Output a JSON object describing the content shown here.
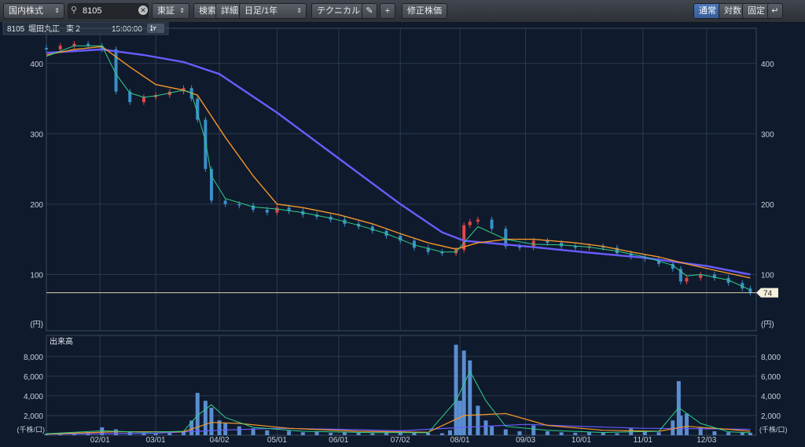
{
  "toolbar": {
    "market_select": "国内株式",
    "search_value": "8105",
    "exchange_select": "東証",
    "search_button": "検索",
    "detail_button": "詳細",
    "period_select": "日足/1年",
    "technical_button": "テクニカル",
    "adjusted_price_button": "修正株価",
    "scale_normal": "通常",
    "scale_log": "対数",
    "scale_fixed": "固定"
  },
  "stock_header": {
    "code": "8105",
    "name": "堀田丸正",
    "market": "東２",
    "time": "15:00:00"
  },
  "colors": {
    "background": "#0f1a2c",
    "grid": "#2a3a52",
    "up_candle": "#e04848",
    "down_candle": "#3a8fc8",
    "ma_short": "#2fd08a",
    "ma_mid": "#f5962a",
    "ma_long": "#6a5cff",
    "volume_bar": "#5a8ed0",
    "price_line": "#d8d0a8"
  },
  "chart_data": {
    "type": "candlestick",
    "price_panel": {
      "y_ticks": [
        100,
        200,
        300,
        400
      ],
      "y_unit": "(円)",
      "ylim": [
        20,
        450
      ],
      "current_price": 74,
      "x_ticks": [
        "02/01",
        "03/01",
        "04/02",
        "05/01",
        "06/01",
        "07/02",
        "08/01",
        "09/03",
        "10/01",
        "11/01",
        "12/03"
      ],
      "close_series": [
        [
          "01/05",
          420
        ],
        [
          "01/12",
          425
        ],
        [
          "01/19",
          428
        ],
        [
          "01/26",
          425
        ],
        [
          "02/02",
          420
        ],
        [
          "02/09",
          360
        ],
        [
          "02/16",
          345
        ],
        [
          "02/23",
          352
        ],
        [
          "03/01",
          355
        ],
        [
          "03/08",
          360
        ],
        [
          "03/15",
          365
        ],
        [
          "03/19",
          350
        ],
        [
          "03/22",
          320
        ],
        [
          "03/26",
          250
        ],
        [
          "03/29",
          205
        ],
        [
          "04/05",
          200
        ],
        [
          "04/12",
          198
        ],
        [
          "04/19",
          192
        ],
        [
          "04/26",
          188
        ],
        [
          "05/01",
          195
        ],
        [
          "05/07",
          190
        ],
        [
          "05/14",
          185
        ],
        [
          "05/21",
          182
        ],
        [
          "05/28",
          178
        ],
        [
          "06/04",
          172
        ],
        [
          "06/11",
          168
        ],
        [
          "06/18",
          162
        ],
        [
          "06/25",
          155
        ],
        [
          "07/02",
          148
        ],
        [
          "07/09",
          138
        ],
        [
          "07/16",
          132
        ],
        [
          "07/23",
          130
        ],
        [
          "07/30",
          135
        ],
        [
          "08/03",
          170
        ],
        [
          "08/06",
          175
        ],
        [
          "08/10",
          178
        ],
        [
          "08/17",
          165
        ],
        [
          "08/24",
          140
        ],
        [
          "08/31",
          138
        ],
        [
          "09/07",
          148
        ],
        [
          "09/14",
          145
        ],
        [
          "09/21",
          140
        ],
        [
          "09/28",
          138
        ],
        [
          "10/05",
          140
        ],
        [
          "10/12",
          138
        ],
        [
          "10/19",
          130
        ],
        [
          "10/26",
          125
        ],
        [
          "11/02",
          122
        ],
        [
          "11/09",
          115
        ],
        [
          "11/16",
          108
        ],
        [
          "11/20",
          90
        ],
        [
          "11/23",
          95
        ],
        [
          "11/30",
          100
        ],
        [
          "12/07",
          95
        ],
        [
          "12/14",
          88
        ],
        [
          "12/21",
          80
        ],
        [
          "12/25",
          74
        ]
      ],
      "ma_short": [
        [
          "01/05",
          410
        ],
        [
          "01/19",
          425
        ],
        [
          "02/02",
          425
        ],
        [
          "02/09",
          385
        ],
        [
          "02/16",
          358
        ],
        [
          "02/23",
          352
        ],
        [
          "03/01",
          354
        ],
        [
          "03/15",
          362
        ],
        [
          "03/19",
          358
        ],
        [
          "03/26",
          290
        ],
        [
          "03/29",
          240
        ],
        [
          "04/05",
          208
        ],
        [
          "04/19",
          196
        ],
        [
          "05/01",
          193
        ],
        [
          "05/14",
          188
        ],
        [
          "05/28",
          180
        ],
        [
          "06/11",
          170
        ],
        [
          "06/25",
          158
        ],
        [
          "07/09",
          142
        ],
        [
          "07/23",
          132
        ],
        [
          "07/30",
          132
        ],
        [
          "08/03",
          145
        ],
        [
          "08/10",
          168
        ],
        [
          "08/24",
          150
        ],
        [
          "09/07",
          143
        ],
        [
          "09/21",
          142
        ],
        [
          "10/05",
          139
        ],
        [
          "10/19",
          133
        ],
        [
          "11/02",
          125
        ],
        [
          "11/16",
          113
        ],
        [
          "11/23",
          98
        ],
        [
          "11/30",
          100
        ],
        [
          "12/14",
          92
        ],
        [
          "12/25",
          78
        ]
      ],
      "ma_mid": [
        [
          "01/05",
          412
        ],
        [
          "01/19",
          420
        ],
        [
          "02/02",
          424
        ],
        [
          "02/16",
          395
        ],
        [
          "03/01",
          370
        ],
        [
          "03/15",
          362
        ],
        [
          "03/22",
          355
        ],
        [
          "04/05",
          295
        ],
        [
          "04/19",
          240
        ],
        [
          "05/01",
          200
        ],
        [
          "05/14",
          195
        ],
        [
          "06/01",
          185
        ],
        [
          "06/18",
          172
        ],
        [
          "07/02",
          158
        ],
        [
          "07/16",
          145
        ],
        [
          "07/30",
          136
        ],
        [
          "08/10",
          145
        ],
        [
          "08/24",
          150
        ],
        [
          "09/07",
          150
        ],
        [
          "09/28",
          145
        ],
        [
          "10/12",
          140
        ],
        [
          "10/26",
          132
        ],
        [
          "11/09",
          125
        ],
        [
          "11/23",
          115
        ],
        [
          "12/07",
          106
        ],
        [
          "12/25",
          95
        ]
      ],
      "ma_long": [
        [
          "01/05",
          415
        ],
        [
          "02/02",
          420
        ],
        [
          "02/23",
          412
        ],
        [
          "03/15",
          402
        ],
        [
          "04/02",
          385
        ],
        [
          "05/01",
          330
        ],
        [
          "06/01",
          265
        ],
        [
          "07/02",
          200
        ],
        [
          "07/23",
          160
        ],
        [
          "08/03",
          148
        ],
        [
          "09/03",
          140
        ],
        [
          "10/01",
          132
        ],
        [
          "11/01",
          124
        ],
        [
          "12/03",
          112
        ],
        [
          "12/25",
          100
        ]
      ]
    },
    "volume_panel": {
      "label": "出来高",
      "y_ticks": [
        "2,000",
        "4,000",
        "6,000",
        "8,000"
      ],
      "y_unit": "(千株/口)",
      "ylim": [
        0,
        9500
      ],
      "bars": [
        [
          "01/05",
          150
        ],
        [
          "01/12",
          100
        ],
        [
          "01/19",
          120
        ],
        [
          "01/26",
          300
        ],
        [
          "02/02",
          800
        ],
        [
          "02/09",
          600
        ],
        [
          "02/16",
          350
        ],
        [
          "02/23",
          200
        ],
        [
          "03/01",
          180
        ],
        [
          "03/08",
          250
        ],
        [
          "03/15",
          400
        ],
        [
          "03/19",
          1500
        ],
        [
          "03/22",
          4300
        ],
        [
          "03/26",
          3500
        ],
        [
          "03/29",
          2800
        ],
        [
          "04/02",
          1500
        ],
        [
          "04/05",
          1200
        ],
        [
          "04/12",
          900
        ],
        [
          "04/19",
          700
        ],
        [
          "04/26",
          500
        ],
        [
          "05/07",
          450
        ],
        [
          "05/14",
          300
        ],
        [
          "05/21",
          350
        ],
        [
          "05/28",
          250
        ],
        [
          "06/04",
          300
        ],
        [
          "06/11",
          250
        ],
        [
          "06/18",
          200
        ],
        [
          "06/25",
          300
        ],
        [
          "07/02",
          350
        ],
        [
          "07/09",
          300
        ],
        [
          "07/16",
          250
        ],
        [
          "07/23",
          200
        ],
        [
          "07/27",
          500
        ],
        [
          "07/30",
          9200
        ],
        [
          "08/01",
          3500
        ],
        [
          "08/03",
          8600
        ],
        [
          "08/06",
          7600
        ],
        [
          "08/10",
          3000
        ],
        [
          "08/14",
          1500
        ],
        [
          "08/17",
          900
        ],
        [
          "08/24",
          600
        ],
        [
          "08/31",
          400
        ],
        [
          "09/07",
          1000
        ],
        [
          "09/14",
          400
        ],
        [
          "09/21",
          300
        ],
        [
          "09/28",
          250
        ],
        [
          "10/05",
          300
        ],
        [
          "10/12",
          250
        ],
        [
          "10/19",
          200
        ],
        [
          "10/26",
          700
        ],
        [
          "11/02",
          350
        ],
        [
          "11/09",
          300
        ],
        [
          "11/16",
          1500
        ],
        [
          "11/19",
          5500
        ],
        [
          "11/20",
          2000
        ],
        [
          "11/23",
          2200
        ],
        [
          "11/30",
          800
        ],
        [
          "12/07",
          400
        ],
        [
          "12/14",
          300
        ],
        [
          "12/21",
          250
        ],
        [
          "12/25",
          250
        ]
      ],
      "ma_short": [
        [
          "01/05",
          150
        ],
        [
          "02/02",
          450
        ],
        [
          "02/23",
          300
        ],
        [
          "03/15",
          400
        ],
        [
          "03/22",
          2000
        ],
        [
          "03/29",
          3100
        ],
        [
          "04/05",
          1800
        ],
        [
          "04/19",
          800
        ],
        [
          "05/14",
          400
        ],
        [
          "06/18",
          260
        ],
        [
          "07/16",
          250
        ],
        [
          "07/30",
          3500
        ],
        [
          "08/06",
          6500
        ],
        [
          "08/14",
          3500
        ],
        [
          "08/24",
          900
        ],
        [
          "09/14",
          500
        ],
        [
          "10/12",
          280
        ],
        [
          "11/09",
          400
        ],
        [
          "11/19",
          2800
        ],
        [
          "11/30",
          1200
        ],
        [
          "12/14",
          350
        ],
        [
          "12/25",
          250
        ]
      ],
      "ma_mid": [
        [
          "01/05",
          120
        ],
        [
          "02/09",
          350
        ],
        [
          "03/15",
          350
        ],
        [
          "03/29",
          1300
        ],
        [
          "04/12",
          1200
        ],
        [
          "05/07",
          700
        ],
        [
          "06/11",
          400
        ],
        [
          "07/16",
          300
        ],
        [
          "08/03",
          2000
        ],
        [
          "08/24",
          2200
        ],
        [
          "09/14",
          1000
        ],
        [
          "10/12",
          500
        ],
        [
          "11/09",
          400
        ],
        [
          "11/23",
          900
        ],
        [
          "12/14",
          600
        ],
        [
          "12/25",
          400
        ]
      ],
      "ma_long": [
        [
          "01/05",
          100
        ],
        [
          "03/01",
          200
        ],
        [
          "04/02",
          500
        ],
        [
          "05/01",
          700
        ],
        [
          "06/01",
          600
        ],
        [
          "07/02",
          450
        ],
        [
          "08/03",
          800
        ],
        [
          "09/03",
          1100
        ],
        [
          "10/01",
          900
        ],
        [
          "11/01",
          700
        ],
        [
          "12/03",
          650
        ],
        [
          "12/25",
          600
        ]
      ]
    }
  }
}
